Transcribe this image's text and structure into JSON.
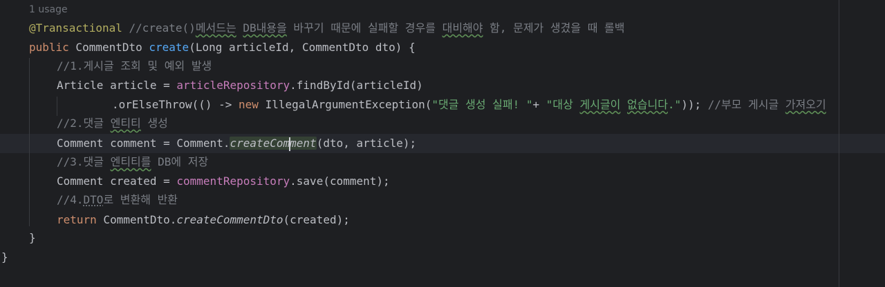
{
  "usage_hint": "1 usage",
  "code": {
    "annotation": "@Transactional",
    "annotation_comment_a": " //create()",
    "annotation_comment_b": "메서드는",
    "annotation_comment_c": " ",
    "annotation_comment_d": "DB내용을",
    "annotation_comment_e": " 바꾸기 때문에 실패할 경우를 ",
    "annotation_comment_f": "대비해야",
    "annotation_comment_g": " 함, 문제가 생겼을 때 롤백",
    "method_kw": "public",
    "method_type": " CommentDto ",
    "method_name": "create",
    "method_params": "(Long articleId, CommentDto dto) {",
    "comment_1": "//1.게시글 조회 및 예외 발생",
    "line_article_a": "Article article = ",
    "line_article_repo": "articleRepository",
    "line_article_b": ".findById(articleId)",
    "line_throw_a": ".orElseThrow(() -> ",
    "line_throw_new": "new",
    "line_throw_b": " IllegalArgumentException(",
    "line_throw_str1": "\"댓글 생성 실패! \"",
    "line_throw_plus": "+ ",
    "line_throw_str2a": "\"대상 ",
    "line_throw_str2b": "게시글이",
    "line_throw_str2c": " ",
    "line_throw_str2d": "없습니다",
    "line_throw_str2e": ".\"",
    "line_throw_c": ")); ",
    "line_throw_cmt_a": "//부모 게시글 ",
    "line_throw_cmt_b": "가져오기",
    "comment_2a": "//2.댓글 ",
    "comment_2b": "엔티티",
    "comment_2c": " 생성",
    "line_comment_a": "Comment comment = Comment.",
    "line_comment_m1": "createCom",
    "line_comment_m2": "ment",
    "line_comment_b": "(dto, article);",
    "comment_3a": "//3.댓글 ",
    "comment_3b": "엔티티를",
    "comment_3c": " DB에 저장",
    "line_created_a": "Comment created = ",
    "line_created_repo": "commentRepository",
    "line_created_b": ".save(comment);",
    "comment_4a": "//4.",
    "comment_4b": "DTO",
    "comment_4c": "로 변환해 반환",
    "return_kw": "return",
    "return_a": " CommentDto.",
    "return_method": "createCommentDto",
    "return_b": "(created);",
    "close_method": "}",
    "close_class": "}"
  },
  "colors": {
    "background": "#1e1f22",
    "default_text": "#bcbec4",
    "keyword": "#cf8e6d",
    "annotation": "#b3ae60",
    "method_decl": "#56a8f5",
    "field": "#c77dbb",
    "string": "#6aab73",
    "comment": "#7a7e85"
  }
}
